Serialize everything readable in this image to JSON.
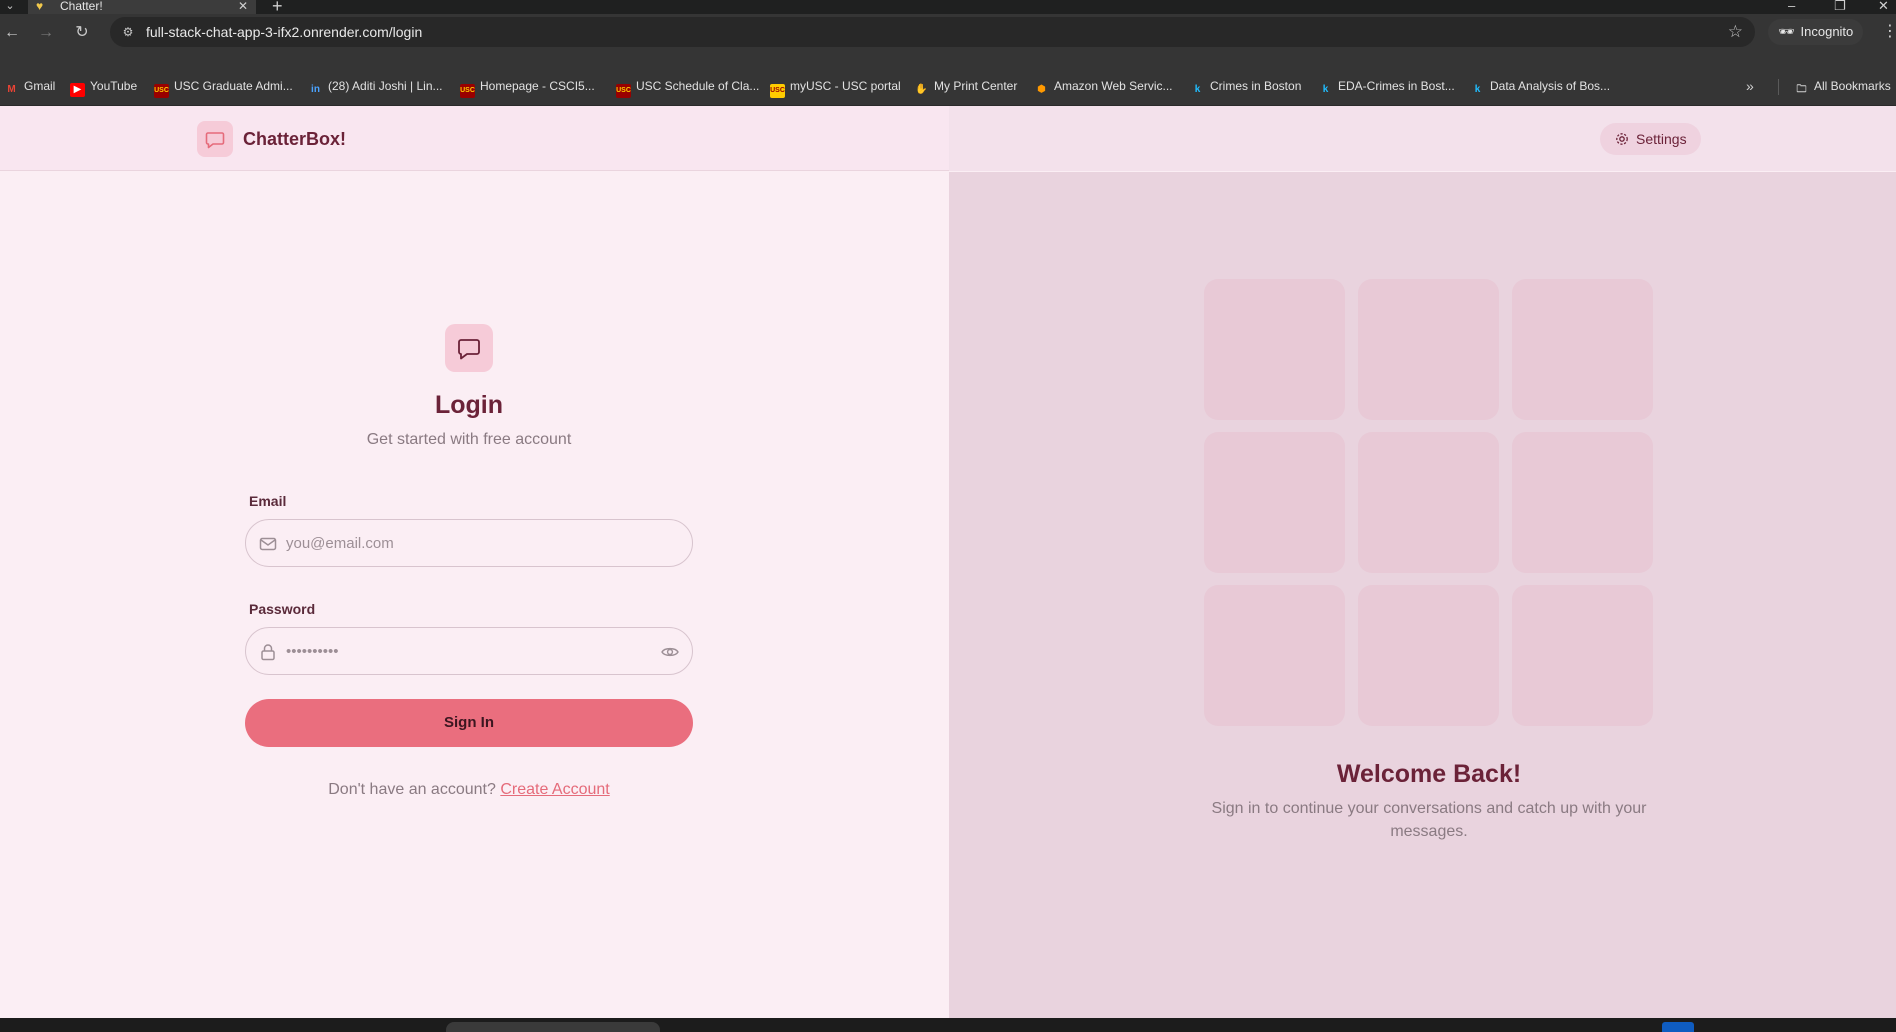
{
  "browser": {
    "tab": {
      "title": "Chatter!",
      "close": "✕"
    },
    "new_tab": "+",
    "window_controls": {
      "minimize": "–",
      "restore": "❐",
      "close": "✕"
    },
    "url": "full-stack-chat-app-3-ifx2.onrender.com/login",
    "incognito_label": "Incognito",
    "bookmarks": [
      {
        "label": "Gmail",
        "icon": "gmail-icon",
        "color": "#ea4335"
      },
      {
        "label": "YouTube",
        "icon": "youtube-icon",
        "color": "#ff0000"
      },
      {
        "label": "USC Graduate Admi...",
        "icon": "usc-icon",
        "color": "#990000"
      },
      {
        "label": "(28) Aditi Joshi | Lin...",
        "icon": "linkedin-icon",
        "color": "#0a66c2"
      },
      {
        "label": "Homepage - CSCI5...",
        "icon": "usc-icon",
        "color": "#990000"
      },
      {
        "label": "USC Schedule of Cla...",
        "icon": "usc-icon",
        "color": "#990000"
      },
      {
        "label": "myUSC - USC portal",
        "icon": "usc-gold-icon",
        "color": "#ffcc00"
      },
      {
        "label": "My Print Center",
        "icon": "hand-icon",
        "color": "#f4b400"
      },
      {
        "label": "Amazon Web Servic...",
        "icon": "aws-icon",
        "color": "#ff9900"
      },
      {
        "label": "Crimes in Boston",
        "icon": "kaggle-icon",
        "color": "#20beff"
      },
      {
        "label": "EDA-Crimes in Bost...",
        "icon": "kaggle-icon",
        "color": "#20beff"
      },
      {
        "label": "Data Analysis of Bos...",
        "icon": "kaggle-icon",
        "color": "#20beff"
      }
    ],
    "all_bookmarks": "All Bookmarks"
  },
  "app": {
    "brand": "ChatterBox!",
    "settings_label": "Settings",
    "login": {
      "title": "Login",
      "subtitle": "Get started with free account",
      "email_label": "Email",
      "email_placeholder": "you@email.com",
      "password_label": "Password",
      "password_placeholder": "••••••••••",
      "submit": "Sign In",
      "signup_prompt": "Don't have an account?",
      "signup_link": "Create Account"
    },
    "welcome": {
      "title": "Welcome Back!",
      "subtitle": "Sign in to continue your conversations and catch up with your messages."
    }
  },
  "colors": {
    "accent": "#ea6e7e",
    "brand_text": "#6b2238",
    "page_bg": "#fbeef4",
    "panel_bg": "#e9d3de",
    "tile": "#e8c9d6"
  }
}
